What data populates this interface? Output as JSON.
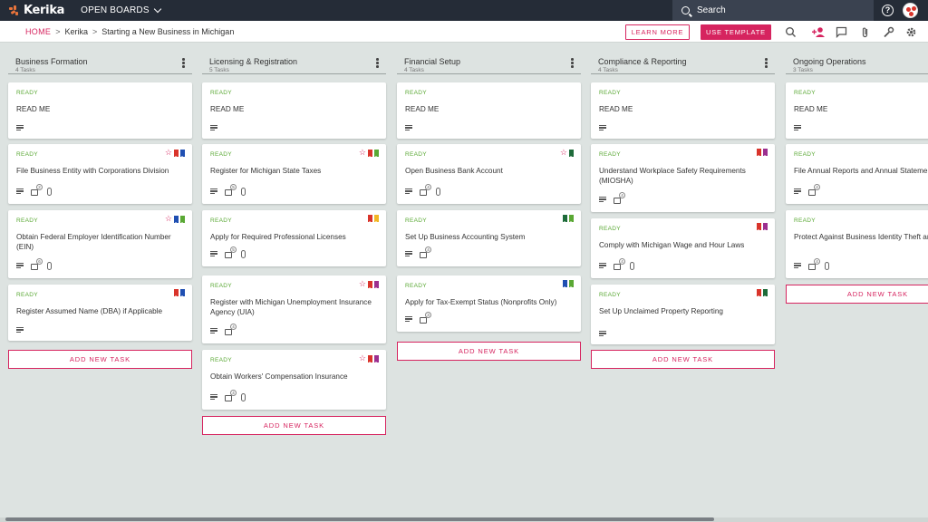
{
  "app": {
    "brand": "Kerika",
    "open_boards": "OPEN BOARDS",
    "search_placeholder": "Search"
  },
  "breadcrumb": {
    "home": "HOME",
    "parent": "Kerika",
    "current": "Starting a New Business in Michigan"
  },
  "actions": {
    "learn_more": "LEARN MORE",
    "use_template": "USE TEMPLATE"
  },
  "colors": {
    "accent": "#d6245f",
    "ready": "#5aa834",
    "topbar": "#252c37",
    "board_bg": "#dde3e1"
  },
  "add_task_label": "ADD NEW TASK",
  "columns": [
    {
      "title": "Business Formation",
      "count": "4 Tasks",
      "cards": [
        {
          "status": "READY",
          "title": "READ ME",
          "star": false,
          "tags": [],
          "checklist": "",
          "attach": false
        },
        {
          "status": "READY",
          "title": "File Business Entity with Corporations Division",
          "star": true,
          "tags": [
            "#d9342b",
            "#1f4fb2"
          ],
          "checklist": "2",
          "attach": true
        },
        {
          "status": "READY",
          "title": "Obtain Federal Employer Identification Number (EIN)",
          "star": true,
          "tags": [
            "#1f4fb2",
            "#5aa834"
          ],
          "checklist": "6",
          "attach": true
        },
        {
          "status": "READY",
          "title": "Register Assumed Name (DBA) if Applicable",
          "star": false,
          "tags": [
            "#d9342b",
            "#1f4fb2"
          ],
          "checklist": "",
          "attach": false
        }
      ]
    },
    {
      "title": "Licensing & Registration",
      "count": "5 Tasks",
      "cards": [
        {
          "status": "READY",
          "title": "READ ME",
          "star": false,
          "tags": [],
          "checklist": "",
          "attach": false
        },
        {
          "status": "READY",
          "title": "Register for Michigan State Taxes",
          "star": true,
          "tags": [
            "#d9342b",
            "#5aa834"
          ],
          "checklist": "5",
          "attach": true
        },
        {
          "status": "READY",
          "title": "Apply for Required Professional Licenses",
          "star": false,
          "tags": [
            "#d9342b",
            "#f2b624"
          ],
          "checklist": "5",
          "attach": true
        },
        {
          "status": "READY",
          "title": "Register with Michigan Unemployment Insurance Agency (UIA)",
          "star": true,
          "tags": [
            "#d9342b",
            "#9c2f8f"
          ],
          "checklist": "4",
          "attach": false
        },
        {
          "status": "READY",
          "title": "Obtain Workers' Compensation Insurance",
          "star": true,
          "tags": [
            "#d9342b",
            "#9c2f8f"
          ],
          "checklist": "4",
          "attach": true
        }
      ]
    },
    {
      "title": "Financial Setup",
      "count": "4 Tasks",
      "cards": [
        {
          "status": "READY",
          "title": "READ ME",
          "star": false,
          "tags": [],
          "checklist": "",
          "attach": false
        },
        {
          "status": "READY",
          "title": "Open Business Bank Account",
          "star": true,
          "tags": [
            "#1e6b3a"
          ],
          "checklist": "4",
          "attach": true
        },
        {
          "status": "READY",
          "title": "Set Up Business Accounting System",
          "star": false,
          "tags": [
            "#1e6b3a",
            "#5aa834"
          ],
          "checklist": "4",
          "attach": false
        },
        {
          "status": "READY",
          "title": "Apply for Tax-Exempt Status (Nonprofits Only)",
          "star": false,
          "tags": [
            "#1f4fb2",
            "#5aa834"
          ],
          "checklist": "3",
          "attach": false
        }
      ]
    },
    {
      "title": "Compliance & Reporting",
      "count": "4 Tasks",
      "cards": [
        {
          "status": "READY",
          "title": "READ ME",
          "star": false,
          "tags": [],
          "checklist": "",
          "attach": false
        },
        {
          "status": "READY",
          "title": "Understand Workplace Safety Requirements (MIOSHA)",
          "star": false,
          "tags": [
            "#d9342b",
            "#9c2f8f"
          ],
          "checklist": "4",
          "attach": false
        },
        {
          "status": "READY",
          "title": "Comply with Michigan Wage and Hour Laws",
          "star": false,
          "tags": [
            "#d9342b",
            "#9c2f8f"
          ],
          "checklist": "4",
          "attach": true
        },
        {
          "status": "READY",
          "title": "Set Up Unclaimed Property Reporting",
          "star": false,
          "tags": [
            "#d9342b",
            "#1e6b3a"
          ],
          "checklist": "",
          "attach": false
        }
      ]
    },
    {
      "title": "Ongoing Operations",
      "count": "3 Tasks",
      "cards": [
        {
          "status": "READY",
          "title": "READ ME",
          "star": false,
          "tags": [],
          "checklist": "",
          "attach": false
        },
        {
          "status": "READY",
          "title": "File Annual Reports and Annual Statements",
          "star": false,
          "tags": [],
          "checklist": "4",
          "attach": false
        },
        {
          "status": "READY",
          "title": "Protect Against Business Identity Theft and Scams",
          "star": false,
          "tags": [],
          "checklist": "4",
          "attach": true
        }
      ]
    }
  ]
}
